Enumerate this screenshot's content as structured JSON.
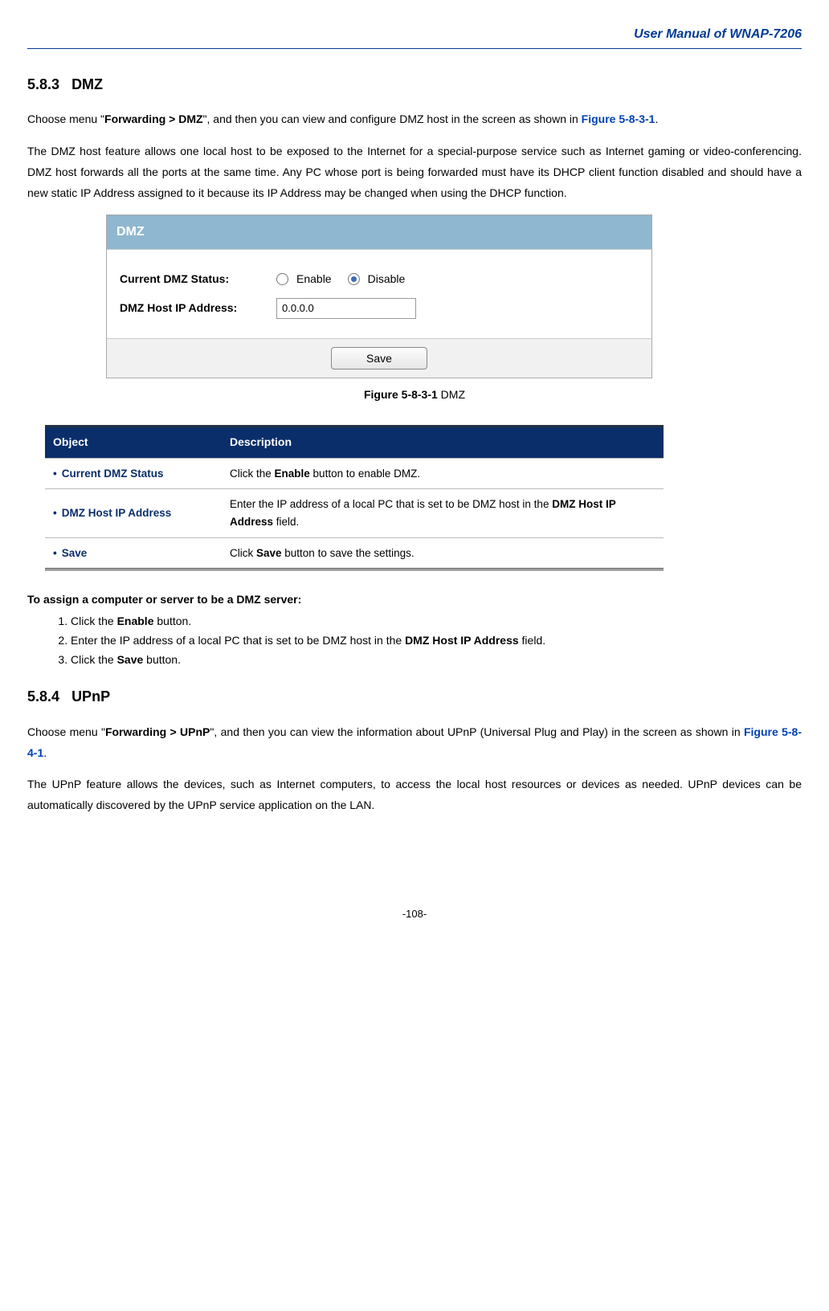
{
  "header": {
    "title": "User Manual of WNAP-7206"
  },
  "section1": {
    "number": "5.8.3",
    "title": "DMZ",
    "intro_pre": "Choose menu \"",
    "intro_bold": "Forwarding > DMZ",
    "intro_post1": "\", and then you can view and configure DMZ host in the screen as shown in ",
    "intro_link": "Figure 5-8-3-1",
    "intro_post2": ".",
    "body": "The DMZ host feature allows one local host to be exposed to the Internet for a special-purpose service such as Internet gaming or video-conferencing. DMZ host forwards all the ports at the same time. Any PC whose port is being forwarded must have its DHCP client function disabled and should have a new static IP Address assigned to it because its IP Address may be changed when using the DHCP function."
  },
  "panel": {
    "title": "DMZ",
    "status_label": "Current DMZ Status:",
    "enable_label": "Enable",
    "disable_label": "Disable",
    "ip_label": "DMZ Host IP Address:",
    "ip_value": "0.0.0.0",
    "save_label": "Save"
  },
  "figure": {
    "label": "Figure 5-8-3-1",
    "text": " DMZ"
  },
  "table": {
    "head": {
      "object": "Object",
      "description": "Description"
    },
    "rows": [
      {
        "object": "Current DMZ Status",
        "desc_pre": "Click the ",
        "desc_bold1": "Enable",
        "desc_mid": " button to enable DMZ.",
        "desc_bold2": "",
        "desc_post": ""
      },
      {
        "object": "DMZ Host IP Address",
        "desc_pre": "Enter the IP address of a local PC that is set to be DMZ host in the ",
        "desc_bold1": "DMZ Host IP Address",
        "desc_mid": " field.",
        "desc_bold2": "",
        "desc_post": ""
      },
      {
        "object": "Save",
        "desc_pre": "Click ",
        "desc_bold1": "Save",
        "desc_mid": " button to save the settings.",
        "desc_bold2": "",
        "desc_post": ""
      }
    ]
  },
  "steps": {
    "title": "To assign a computer or server to be a DMZ server",
    "items": [
      {
        "pre": "Click the ",
        "bold": "Enable",
        "post": " button."
      },
      {
        "pre": "Enter the IP address of a local PC that is set to be DMZ host in the ",
        "bold": "DMZ Host IP Address",
        "post": " field."
      },
      {
        "pre": "Click the ",
        "bold": "Save",
        "post": " button."
      }
    ]
  },
  "section2": {
    "number": "5.8.4",
    "title": "UPnP",
    "intro_pre": "Choose menu \"",
    "intro_bold": "Forwarding > UPnP",
    "intro_post1": "\", and then you can view the information about UPnP (Universal Plug and Play) in the screen as shown in ",
    "intro_link": "Figure 5-8-4-1",
    "intro_post2": ".",
    "body": "The UPnP feature allows the devices, such as Internet computers, to access the local host resources or devices as needed. UPnP devices can be automatically discovered by the UPnP service application on the LAN."
  },
  "page_number": "-108-"
}
